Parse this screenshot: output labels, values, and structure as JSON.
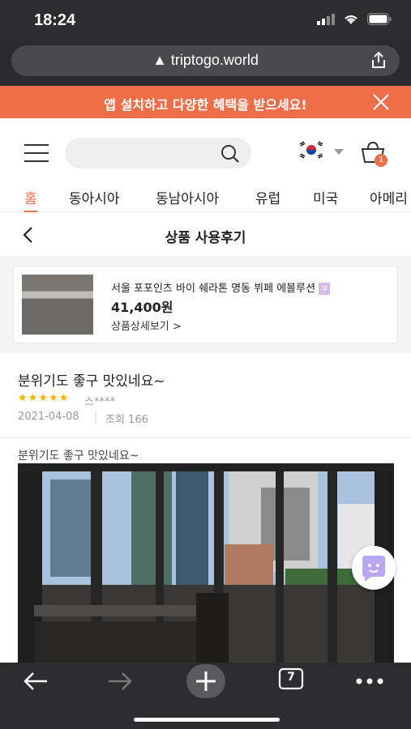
{
  "status_bar": {
    "time": "18:24"
  },
  "browser": {
    "url": "▲ triptogo.world"
  },
  "banner": {
    "text": "앱 설치하고 다양한 혜택을 받으세요!"
  },
  "header": {
    "cart_count": "1"
  },
  "nav": {
    "tabs": [
      "홈",
      "동아시아",
      "동남아시아",
      "유럽",
      "미국",
      "아메리"
    ],
    "active": "홈"
  },
  "subheader": {
    "title": "상품 사용후기"
  },
  "product": {
    "name": "서울 포포인츠 바이 쉐라톤 명동 뷔페 에볼루션",
    "tag": "쿠",
    "price": "41,400원",
    "detail_link": "상품상세보기 >"
  },
  "review": {
    "title": "분위기도 좋구 맛있네요~",
    "stars": "★★★★★",
    "rating": 5,
    "author": "스****",
    "date": "2021-04-08",
    "views": "조회 166",
    "body": "분위기도 좋구 맛있네요~"
  },
  "bottom_toolbar": {
    "tab_count": "7"
  },
  "colors": {
    "accent": "#ef6e4a",
    "star": "#f5b400",
    "chrome": "#2d2d2f"
  }
}
